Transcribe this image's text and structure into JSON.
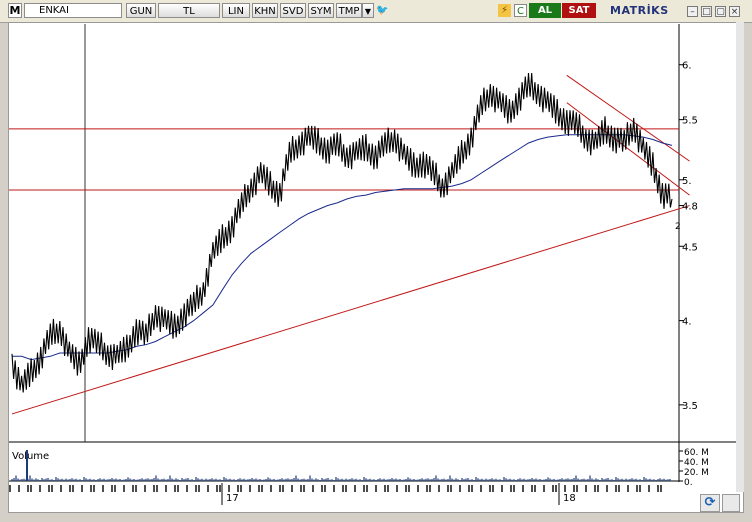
{
  "toolbar": {
    "m_label": "M",
    "symbol": "ENKAI",
    "buttons": [
      {
        "label": "GUN"
      },
      {
        "label": "TL"
      },
      {
        "label": "LIN"
      },
      {
        "label": "KHN"
      },
      {
        "label": "SVD"
      },
      {
        "label": "SYM"
      },
      {
        "label": "TMP"
      }
    ],
    "buy_label": "AL",
    "sell_label": "SAT",
    "brand": "MATRİKS"
  },
  "chart_data": {
    "type": "line",
    "y_axis_scale": "log",
    "y_ticks": [
      3.5,
      4,
      4.5,
      4.8,
      5,
      5.5,
      6
    ],
    "y_tick_labels": [
      "3.5",
      "4.",
      "4.5",
      "4.8",
      "5.",
      "5.5",
      "6."
    ],
    "x_tick_labels": [
      "17",
      "18"
    ],
    "volume_label": "Volume",
    "volume_ticks": [
      "60. M",
      "40. M",
      "20. M",
      "0."
    ],
    "last_price_marker": "2",
    "series": [
      {
        "role": "price",
        "color": "#000000",
        "values": [
          3.75,
          3.6,
          3.68,
          3.78,
          3.9,
          3.95,
          3.8,
          3.72,
          3.9,
          3.85,
          3.8,
          3.78,
          3.82,
          3.95,
          3.9,
          4.05,
          4.0,
          3.95,
          4.05,
          4.1,
          4.2,
          4.45,
          4.55,
          4.65,
          4.8,
          4.95,
          5.05,
          4.95,
          4.9,
          5.2,
          5.3,
          5.35,
          5.3,
          5.25,
          5.28,
          5.2,
          5.22,
          5.25,
          5.2,
          5.28,
          5.35,
          5.2,
          5.1,
          5.15,
          5.05,
          4.95,
          5.05,
          5.2,
          5.35,
          5.6,
          5.75,
          5.65,
          5.55,
          5.7,
          5.8,
          5.75,
          5.65,
          5.55,
          5.5,
          5.45,
          5.35,
          5.3,
          5.4,
          5.35,
          5.3,
          5.45,
          5.25,
          5.1,
          4.9,
          4.85
        ]
      },
      {
        "role": "moving-average",
        "color": "#1a2a8c",
        "values": [
          3.78,
          3.78,
          3.76,
          3.77,
          3.78,
          3.8,
          3.8,
          3.8,
          3.8,
          3.8,
          3.8,
          3.81,
          3.82,
          3.84,
          3.85,
          3.87,
          3.9,
          3.93,
          3.96,
          4.0,
          4.05,
          4.1,
          4.2,
          4.3,
          4.38,
          4.45,
          4.5,
          4.55,
          4.6,
          4.65,
          4.7,
          4.74,
          4.77,
          4.8,
          4.82,
          4.85,
          4.87,
          4.88,
          4.9,
          4.91,
          4.92,
          4.93,
          4.93,
          4.93,
          4.93,
          4.94,
          4.95,
          4.97,
          5.0,
          5.05,
          5.1,
          5.15,
          5.2,
          5.25,
          5.3,
          5.33,
          5.35,
          5.36,
          5.37,
          5.37,
          5.37,
          5.37,
          5.37,
          5.37,
          5.37,
          5.36,
          5.35,
          5.33,
          5.3,
          5.28
        ]
      }
    ],
    "horizontal_lines": [
      5.42,
      4.92
    ],
    "trend_lines": [
      {
        "from": {
          "index": 0,
          "value": 3.45
        },
        "to": {
          "index": 70,
          "value": 4.8
        }
      },
      {
        "from": {
          "index": 58,
          "value": 5.9
        },
        "to": {
          "index": 70,
          "value": 5.15
        }
      },
      {
        "from": {
          "index": 58,
          "value": 5.65
        },
        "to": {
          "index": 70,
          "value": 4.88
        }
      }
    ],
    "volume_values": [
      4,
      3,
      6,
      3,
      2,
      3,
      4,
      3,
      2,
      6,
      3,
      2,
      4,
      3,
      2,
      3,
      2,
      3,
      4,
      2,
      3,
      2,
      4,
      3,
      2,
      3,
      2,
      4,
      3,
      2,
      3,
      2,
      3,
      2,
      3,
      2,
      4,
      3,
      2,
      3,
      2,
      3,
      2,
      2,
      3,
      2,
      3,
      2,
      3,
      4,
      3,
      2,
      3,
      2,
      3,
      2,
      3,
      2,
      4,
      3,
      2,
      3,
      2,
      3,
      2,
      3,
      2,
      3,
      4,
      3
    ],
    "volume_spike": 62,
    "grid": false,
    "colors": {
      "price": "#000000",
      "ma": "#1a2a8c",
      "lines": "#c01818",
      "volume": "#1e3a78"
    }
  }
}
